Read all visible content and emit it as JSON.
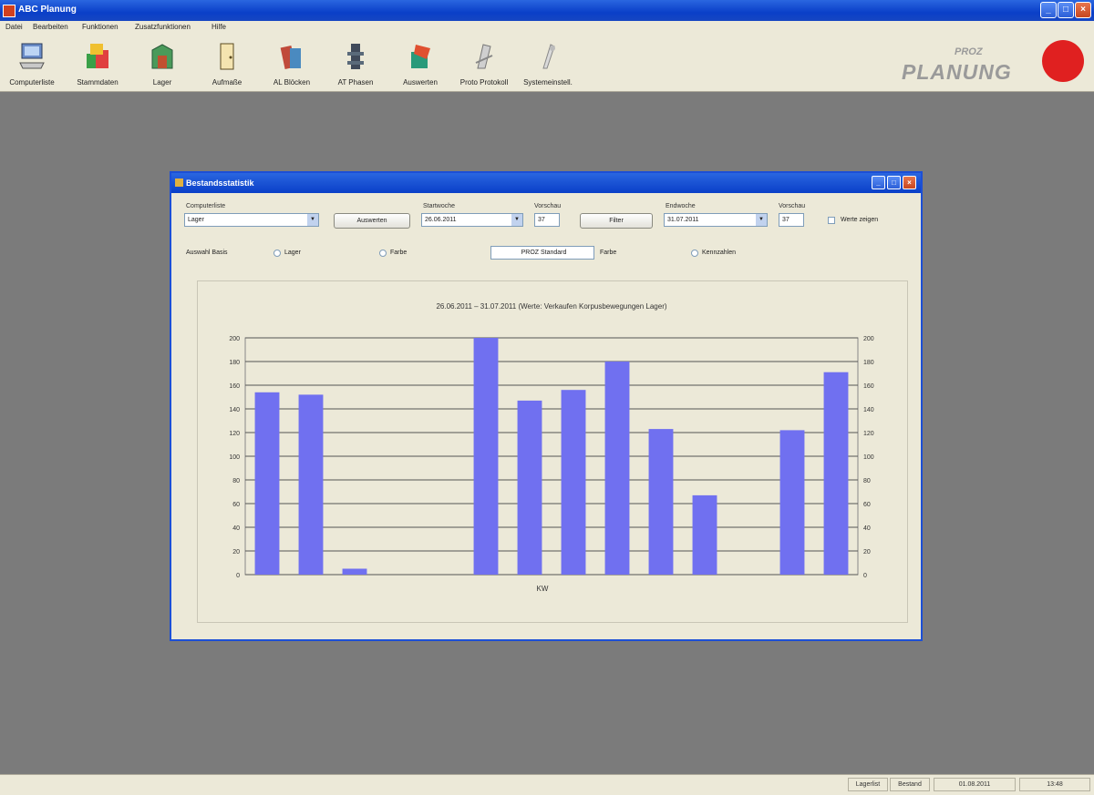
{
  "window": {
    "title": "ABC Planung"
  },
  "menu": [
    "Datei",
    "Bearbeiten",
    "Funktionen",
    "Zusatzfunktionen",
    "Hilfe"
  ],
  "toolbar": [
    {
      "label": "Computerliste",
      "icon": "computer-icon",
      "color": "#6a8cc8"
    },
    {
      "label": "Stammdaten",
      "icon": "stacked-boxes-icon",
      "color": "#3aa048"
    },
    {
      "label": "Lager",
      "icon": "warehouse-icon",
      "color": "#4a9a5a"
    },
    {
      "label": "Aufmaße",
      "icon": "door-icon",
      "color": "#c8a040"
    },
    {
      "label": "AL Blöcken",
      "icon": "blocks-icon",
      "color": "#c04a3a"
    },
    {
      "label": "AT Phasen",
      "icon": "tower-icon",
      "color": "#404a5a"
    },
    {
      "label": "Auswerten",
      "icon": "analysis-icon",
      "color": "#2a9a7a"
    },
    {
      "label": "Proto Protokoll",
      "icon": "protocol-icon",
      "color": "#8a8a8a"
    },
    {
      "label": "Systemeinstell.",
      "icon": "settings-icon",
      "color": "#9a9a9a"
    }
  ],
  "logo": {
    "main": "PLANUNG",
    "sub": "PROZ"
  },
  "dialog": {
    "title": "Bestandsstatistik",
    "computer_label": "Computerliste",
    "computer_value": "Lager",
    "evaluate_button": "Auswerten",
    "start_label": "Startwoche",
    "start_value": "26.06.2011",
    "week_label": "Vorschau",
    "week_value": "37",
    "step_button": "Filter",
    "end_label": "Endwoche",
    "end_value": "31.07.2011",
    "week2_label": "Vorschau",
    "week2_value": "37",
    "show_values_label": "Werte zeigen",
    "filter_label": "Auswahl Basis",
    "radio_1": "Lager",
    "radio_2": "Farbe",
    "center_field": "PROZ Standard",
    "right_label": "Farbe",
    "radio_3": "Kennzahlen"
  },
  "chart_data": {
    "type": "bar",
    "title": "26.06.2011 – 31.07.2011 (Werte: Verkaufen Korpusbewegungen Lager)",
    "xlabel": "KW",
    "ylim": [
      0,
      200
    ],
    "yticks": [
      0,
      20,
      40,
      60,
      80,
      100,
      120,
      140,
      160,
      180,
      200
    ],
    "y2ticks": [
      0,
      20,
      40,
      60,
      80,
      100,
      120,
      140,
      160,
      180,
      200
    ],
    "grid": true,
    "bar_color": "#7070f0",
    "values": [
      154,
      152,
      5,
      0,
      0,
      200,
      147,
      156,
      180,
      123,
      67,
      0,
      122,
      171
    ]
  },
  "status": {
    "panel_1": "Lagerlist",
    "panel_2": "Bestand",
    "date": "01.08.2011",
    "time": "13:48"
  }
}
